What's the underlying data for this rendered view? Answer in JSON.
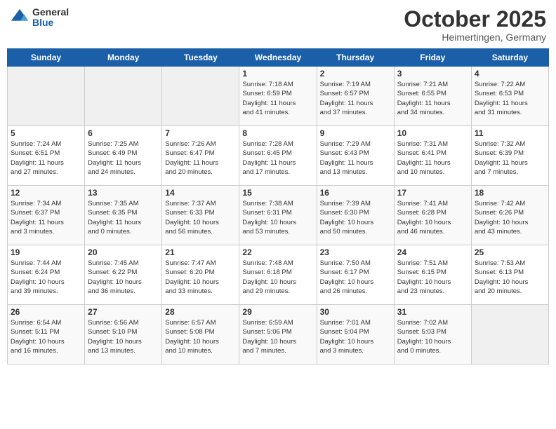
{
  "logo": {
    "general": "General",
    "blue": "Blue"
  },
  "title": "October 2025",
  "location": "Heimertingen, Germany",
  "days_of_week": [
    "Sunday",
    "Monday",
    "Tuesday",
    "Wednesday",
    "Thursday",
    "Friday",
    "Saturday"
  ],
  "weeks": [
    [
      {
        "day": "",
        "info": ""
      },
      {
        "day": "",
        "info": ""
      },
      {
        "day": "",
        "info": ""
      },
      {
        "day": "1",
        "info": "Sunrise: 7:18 AM\nSunset: 6:59 PM\nDaylight: 11 hours\nand 41 minutes."
      },
      {
        "day": "2",
        "info": "Sunrise: 7:19 AM\nSunset: 6:57 PM\nDaylight: 11 hours\nand 37 minutes."
      },
      {
        "day": "3",
        "info": "Sunrise: 7:21 AM\nSunset: 6:55 PM\nDaylight: 11 hours\nand 34 minutes."
      },
      {
        "day": "4",
        "info": "Sunrise: 7:22 AM\nSunset: 6:53 PM\nDaylight: 11 hours\nand 31 minutes."
      }
    ],
    [
      {
        "day": "5",
        "info": "Sunrise: 7:24 AM\nSunset: 6:51 PM\nDaylight: 11 hours\nand 27 minutes."
      },
      {
        "day": "6",
        "info": "Sunrise: 7:25 AM\nSunset: 6:49 PM\nDaylight: 11 hours\nand 24 minutes."
      },
      {
        "day": "7",
        "info": "Sunrise: 7:26 AM\nSunset: 6:47 PM\nDaylight: 11 hours\nand 20 minutes."
      },
      {
        "day": "8",
        "info": "Sunrise: 7:28 AM\nSunset: 6:45 PM\nDaylight: 11 hours\nand 17 minutes."
      },
      {
        "day": "9",
        "info": "Sunrise: 7:29 AM\nSunset: 6:43 PM\nDaylight: 11 hours\nand 13 minutes."
      },
      {
        "day": "10",
        "info": "Sunrise: 7:31 AM\nSunset: 6:41 PM\nDaylight: 11 hours\nand 10 minutes."
      },
      {
        "day": "11",
        "info": "Sunrise: 7:32 AM\nSunset: 6:39 PM\nDaylight: 11 hours\nand 7 minutes."
      }
    ],
    [
      {
        "day": "12",
        "info": "Sunrise: 7:34 AM\nSunset: 6:37 PM\nDaylight: 11 hours\nand 3 minutes."
      },
      {
        "day": "13",
        "info": "Sunrise: 7:35 AM\nSunset: 6:35 PM\nDaylight: 11 hours\nand 0 minutes."
      },
      {
        "day": "14",
        "info": "Sunrise: 7:37 AM\nSunset: 6:33 PM\nDaylight: 10 hours\nand 56 minutes."
      },
      {
        "day": "15",
        "info": "Sunrise: 7:38 AM\nSunset: 6:31 PM\nDaylight: 10 hours\nand 53 minutes."
      },
      {
        "day": "16",
        "info": "Sunrise: 7:39 AM\nSunset: 6:30 PM\nDaylight: 10 hours\nand 50 minutes."
      },
      {
        "day": "17",
        "info": "Sunrise: 7:41 AM\nSunset: 6:28 PM\nDaylight: 10 hours\nand 46 minutes."
      },
      {
        "day": "18",
        "info": "Sunrise: 7:42 AM\nSunset: 6:26 PM\nDaylight: 10 hours\nand 43 minutes."
      }
    ],
    [
      {
        "day": "19",
        "info": "Sunrise: 7:44 AM\nSunset: 6:24 PM\nDaylight: 10 hours\nand 39 minutes."
      },
      {
        "day": "20",
        "info": "Sunrise: 7:45 AM\nSunset: 6:22 PM\nDaylight: 10 hours\nand 36 minutes."
      },
      {
        "day": "21",
        "info": "Sunrise: 7:47 AM\nSunset: 6:20 PM\nDaylight: 10 hours\nand 33 minutes."
      },
      {
        "day": "22",
        "info": "Sunrise: 7:48 AM\nSunset: 6:18 PM\nDaylight: 10 hours\nand 29 minutes."
      },
      {
        "day": "23",
        "info": "Sunrise: 7:50 AM\nSunset: 6:17 PM\nDaylight: 10 hours\nand 26 minutes."
      },
      {
        "day": "24",
        "info": "Sunrise: 7:51 AM\nSunset: 6:15 PM\nDaylight: 10 hours\nand 23 minutes."
      },
      {
        "day": "25",
        "info": "Sunrise: 7:53 AM\nSunset: 6:13 PM\nDaylight: 10 hours\nand 20 minutes."
      }
    ],
    [
      {
        "day": "26",
        "info": "Sunrise: 6:54 AM\nSunset: 5:11 PM\nDaylight: 10 hours\nand 16 minutes."
      },
      {
        "day": "27",
        "info": "Sunrise: 6:56 AM\nSunset: 5:10 PM\nDaylight: 10 hours\nand 13 minutes."
      },
      {
        "day": "28",
        "info": "Sunrise: 6:57 AM\nSunset: 5:08 PM\nDaylight: 10 hours\nand 10 minutes."
      },
      {
        "day": "29",
        "info": "Sunrise: 6:59 AM\nSunset: 5:06 PM\nDaylight: 10 hours\nand 7 minutes."
      },
      {
        "day": "30",
        "info": "Sunrise: 7:01 AM\nSunset: 5:04 PM\nDaylight: 10 hours\nand 3 minutes."
      },
      {
        "day": "31",
        "info": "Sunrise: 7:02 AM\nSunset: 5:03 PM\nDaylight: 10 hours\nand 0 minutes."
      },
      {
        "day": "",
        "info": ""
      }
    ]
  ]
}
